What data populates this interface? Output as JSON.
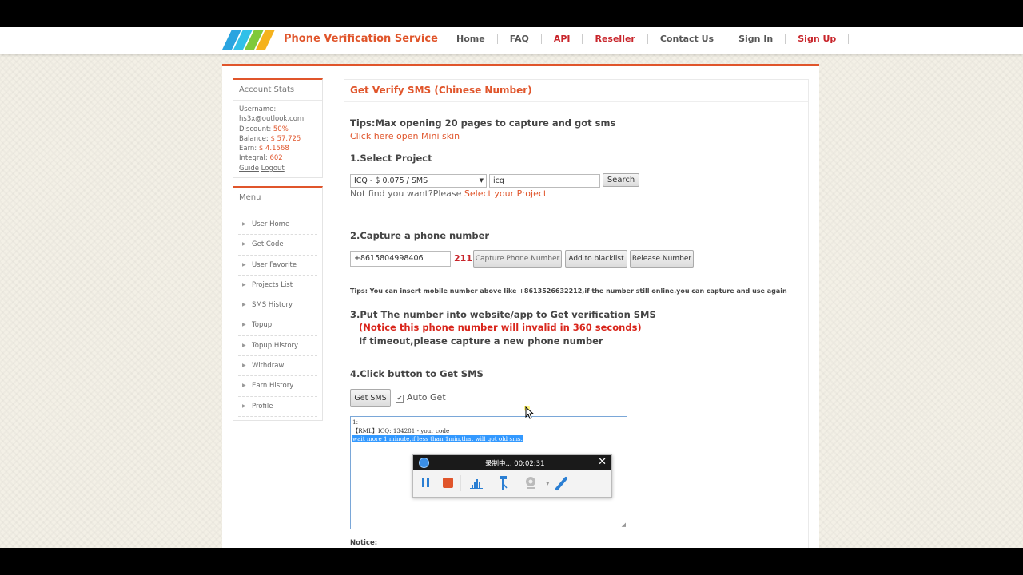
{
  "header": {
    "brand": "Phone Verification Service",
    "nav": [
      {
        "label": "Home",
        "highlight": false
      },
      {
        "label": "FAQ",
        "highlight": false
      },
      {
        "label": "API",
        "highlight": true
      },
      {
        "label": "Reseller",
        "highlight": true
      },
      {
        "label": "Contact Us",
        "highlight": false
      },
      {
        "label": "Sign In",
        "highlight": false
      },
      {
        "label": "Sign Up",
        "highlight": true
      }
    ]
  },
  "sidebar": {
    "stats_title": "Account Stats",
    "username_label": "Username:",
    "username": "hs3x@outlook.com",
    "discount_label": "Discount:",
    "discount": "50%",
    "balance_label": "Balance:",
    "balance": "$ 57.725",
    "earn_label": "Earn:",
    "earn": "$ 4.1568",
    "integral_label": "Integral:",
    "integral": "602",
    "guide_label": "Guide",
    "logout_label": "Logout",
    "menu_title": "Menu",
    "menu_items": [
      "User Home",
      "Get Code",
      "User Favorite",
      "Projects List",
      "SMS History",
      "Topup",
      "Topup History",
      "Withdraw",
      "Earn History",
      "Profile"
    ]
  },
  "main": {
    "title": "Get Verify SMS (Chinese Number)",
    "tips": "Tips:Max opening 20 pages to capture and got sms",
    "mini_skin_link": "Click here open Mini skin",
    "step1": "1.Select Project",
    "project_select": "ICQ - $ 0.075 / SMS",
    "search_value": "icq",
    "search_button": "Search",
    "not_find_text": "Not find you want?Please",
    "select_project_link": "Select your Project",
    "step2": "2.Capture a phone number",
    "phone_number": "+8615804998406",
    "count": "211",
    "capture_button": "Capture Phone Number",
    "blacklist_button": "Add to blacklist",
    "release_button": "Release Number",
    "tips2": "Tips: You can insert mobile number above like +8613526632212,if the number still online.you can capture and use again",
    "step3": "3.Put The number into website/app to Get verification SMS",
    "notice_red": "(Notice this phone number will invalid in 360 seconds)",
    "timeout_text": "If timeout,please capture a new phone number",
    "step4": "4.Click button to Get SMS",
    "get_sms_button": "Get SMS",
    "auto_get_label": "Auto Get",
    "auto_get_checked": true,
    "sms_line1": "1:",
    "sms_line2": "【RML】ICQ: 134281 - your code",
    "sms_line3": "wait more 1 minute,if less than 1min,that will got old sms.",
    "notice_label": "Notice:"
  },
  "recorder": {
    "title": "录制中... 00:02:31",
    "close": "✕"
  },
  "colors": {
    "accent": "#e0552b",
    "red": "#c8252b",
    "notice_red": "#d9261c"
  }
}
